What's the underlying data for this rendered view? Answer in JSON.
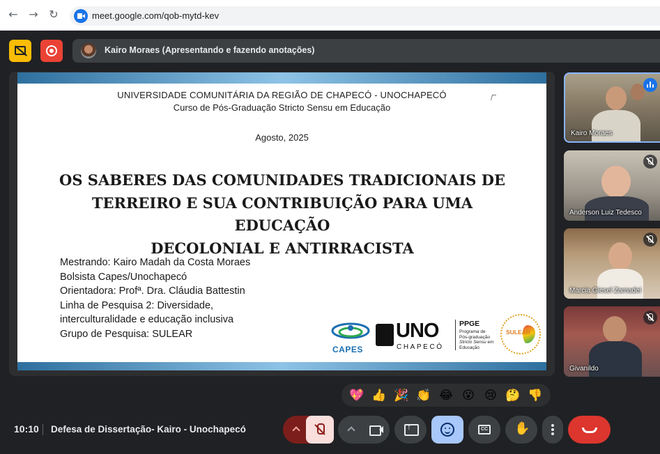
{
  "browser": {
    "url": "meet.google.com/qob-mytd-kev"
  },
  "presenter": {
    "label": "Kairo Moraes (Apresentando e fazendo anotações)"
  },
  "slide": {
    "university": "UNIVERSIDADE COMUNITÁRIA DA REGIÃO DE CHAPECÓ - UNOCHAPECÓ",
    "course": "Curso de Pós-Graduação Stricto Sensu em Educação",
    "date": "Agosto, 2025",
    "title_lines": [
      "OS SABERES DAS COMUNIDADES TRADICIONAIS DE",
      "TERREIRO E SUA CONTRIBUIÇÃO PARA UMA EDUCAÇÃO",
      "DECOLONIAL E ANTIRRACISTA"
    ],
    "info_lines": [
      "Mestrando: Kairo Madah da Costa Moraes",
      "Bolsista Capes/Unochapecó",
      "Orientadora: Profª. Dra. Cláudia Battestin",
      "Linha de Pesquisa 2: Diversidade,",
      "interculturalidade e educação inclusiva",
      "Grupo de Pesquisa: SULEAR"
    ],
    "logos": {
      "capes": "CAPES",
      "uno": "UNO",
      "uno_sub": "CHAPECÓ",
      "ppge": "PPGE",
      "ppge_sub_lines": [
        "Programa de",
        "Pós-graduação",
        "Stricto Sensu em",
        "Educação"
      ],
      "sulear": "SULEAR"
    }
  },
  "participants": [
    {
      "name": "Kairo Moraes",
      "status": "speaking"
    },
    {
      "name": "Anderson Luiz Tedesco",
      "status": "muted"
    },
    {
      "name": "Marcia Giesel Zamadei",
      "status": "muted"
    },
    {
      "name": "Givanildo",
      "status": "muted"
    }
  ],
  "reactions": [
    "💖",
    "👍",
    "🎉",
    "👏",
    "😂",
    "😮",
    "😢",
    "🤔",
    "👎"
  ],
  "bottom_bar": {
    "time": "10:10",
    "meeting_title": "Defesa de Dissertação- Kairo - Unochapecó",
    "cc_label": "CC",
    "hand_glyph": "✋"
  },
  "colors": {
    "background": "#202124",
    "accent": "#8ab4f8",
    "hangup": "#dc362e",
    "present_warning": "#fbbc04",
    "record": "#ea4335"
  }
}
